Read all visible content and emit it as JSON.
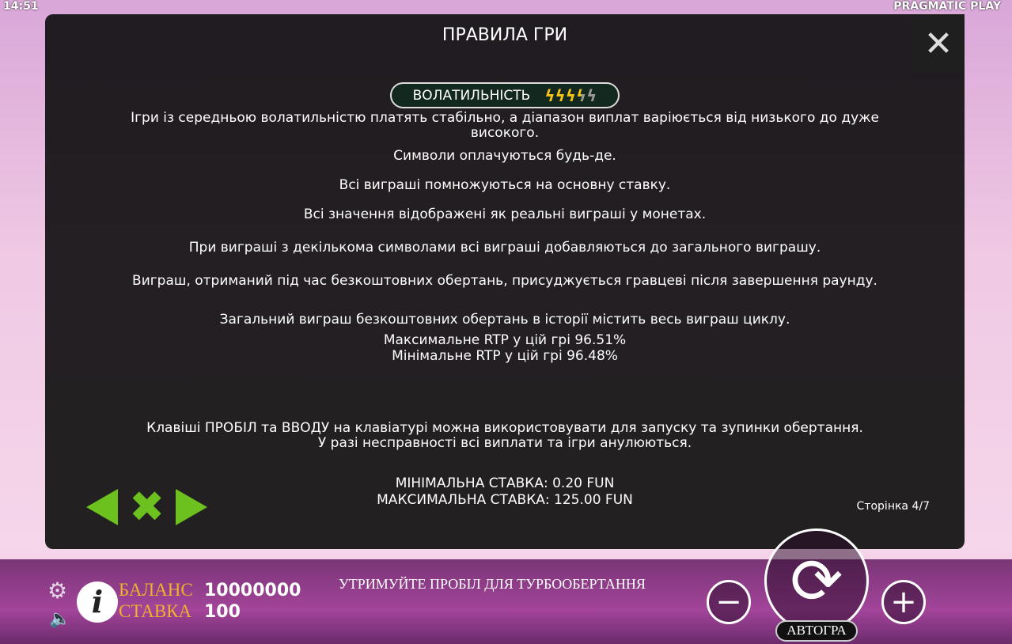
{
  "status": {
    "time": "14:51",
    "brand": "PRAGMATIC PLAY"
  },
  "modal": {
    "title": "ПРАВИЛА ГРИ",
    "volatility": {
      "label": "ВОЛАТИЛЬНІСТЬ",
      "level": 3.5,
      "max": 5
    },
    "lines": [
      "Ігри із середньою волатильністю платять стабільно, а діапазон виплат варіюється від низького до дуже високого.",
      "Символи оплачуються будь-де.",
      "Всі виграші помножуються на основну ставку.",
      "Всі значення відображені як реальні виграші у монетах.",
      "При виграші з декількома символами всі виграші добавляються до загального виграшу.",
      "Виграш, отриманий під час безкоштовних обертань, присуджується гравцеві після завершення раунду.",
      "Загальний виграш безкоштовних обертань в історії містить весь виграш циклу.",
      "Максимальне RTP у цій грі 96.51%",
      "Мінімальне RTP у цій грі 96.48%",
      "Клавіші ПРОБІЛ та ВВОДУ на клавіатурі можна використовувати для запуску та зупинки обертання.",
      "У разі несправності всі виплати та ігри анулюються.",
      "МІНІМАЛЬНА СТАВКА: 0.20 FUN",
      "МАКСИМАЛЬНА СТАВКА: 125.00 FUN"
    ],
    "page": "Сторінка 4/7"
  },
  "bottom": {
    "balance_label": "БАЛАНС",
    "balance": "10000000",
    "bet_label": "СТАВКА",
    "bet": "100",
    "hint": "УТРИМУЙТЕ ПРОБІЛ ДЛЯ ТУРБООБЕРТАННЯ",
    "autoplay": "АВТОГРА"
  }
}
